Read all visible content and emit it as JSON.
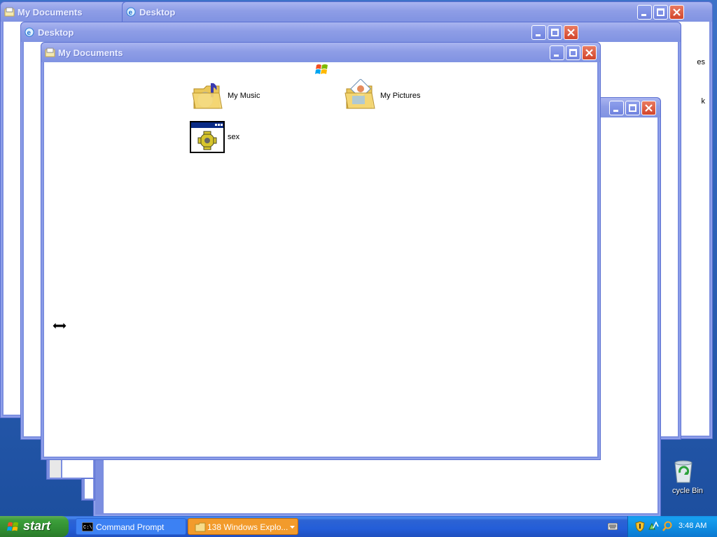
{
  "windows": [
    {
      "id": "w1",
      "title": "My Documents"
    },
    {
      "id": "w2",
      "title": "Desktop"
    },
    {
      "id": "w3",
      "title": "Desktop"
    },
    {
      "id": "w4",
      "title": "My Documents"
    }
  ],
  "front_window": {
    "title": "My Documents",
    "items": [
      {
        "label": "My Music",
        "icon": "music-folder-icon"
      },
      {
        "label": "My Pictures",
        "icon": "pictures-folder-icon"
      },
      {
        "label": "sex",
        "icon": "program-icon"
      }
    ]
  },
  "desktop": {
    "recycle_bin_label": "cycle Bin",
    "partial_text_1": "es",
    "partial_text_2": "k"
  },
  "taskbar": {
    "start_label": "start",
    "tasks": [
      {
        "label": "Command Prompt",
        "icon": "cmd-icon"
      },
      {
        "label": "138 Windows Explo...",
        "icon": "folder-icon"
      }
    ],
    "clock": "3:48 AM"
  },
  "colors": {
    "titlebar_inactive": "#8e9de6",
    "taskbar": "#245ed8",
    "start_button": "#3c9f3a",
    "active_task": "#f29b2c",
    "tray": "#0e8be0"
  }
}
